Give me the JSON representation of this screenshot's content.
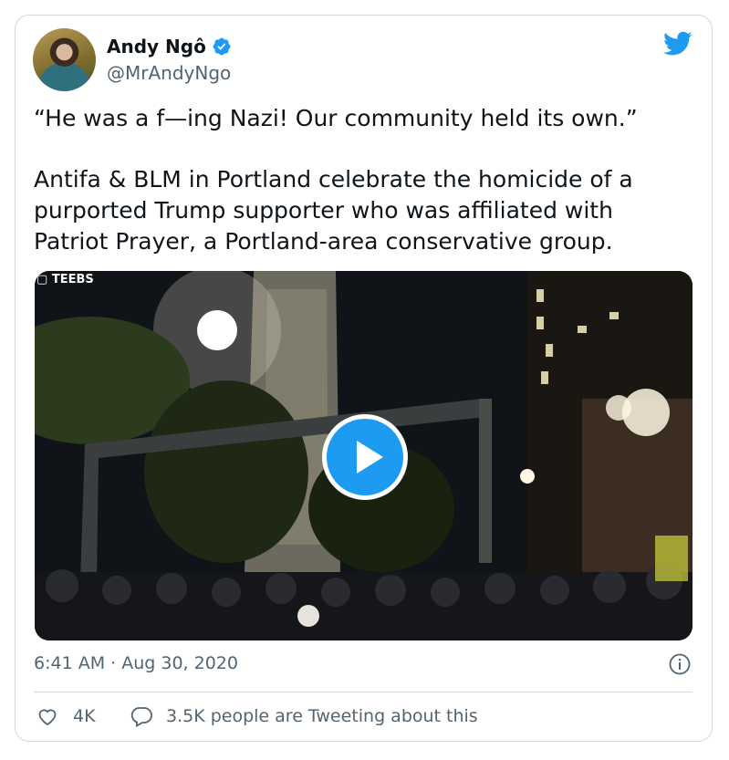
{
  "tweet": {
    "author_name": "Andy Ngô",
    "author_handle": "@MrAndyNgo",
    "verified_icon": "verified-badge-icon",
    "platform_icon": "twitter-bird-icon",
    "quote": "“He was a f—ing Nazi! Our community held its own.”",
    "body": "Antifa & BLM in Portland celebrate the homicide of a purported Trump supporter who was affiliated with Patriot Prayer, a Portland-area conservative group.",
    "video": {
      "watermark": "TEEBS",
      "play_icon": "play-icon"
    },
    "timestamp": "6:41 AM · Aug 30, 2020",
    "likes": "4K",
    "conversation": "3.5K people are Tweeting about this"
  },
  "colors": {
    "accent": "#1d9bf0",
    "secondary_text": "#536471",
    "border": "#cfd9de"
  }
}
